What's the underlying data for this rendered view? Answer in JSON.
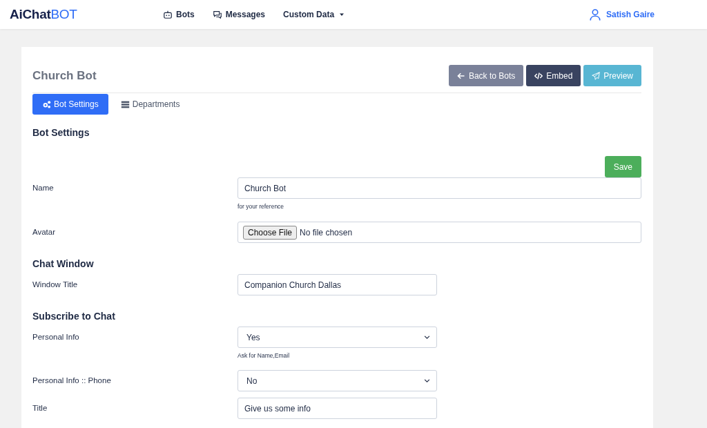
{
  "navbar": {
    "logo": "**AiChat**BOT",
    "links": [
      {
        "label": "Bots",
        "kind": "robot",
        "dropdown": false
      },
      {
        "label": "Messages",
        "kind": "chat",
        "dropdown": false
      },
      {
        "label": "Custom Data",
        "kind": "menu",
        "dropdown": true
      }
    ],
    "user": "Satish Gaire"
  },
  "page": {
    "title": "Church Bot",
    "buttons": [
      {
        "label": "Back to Bots",
        "kind": "back"
      },
      {
        "label": "Embed",
        "kind": "embed"
      },
      {
        "label": "Preview",
        "kind": "preview"
      }
    ]
  },
  "tabs": [
    {
      "label": "Bot Settings",
      "kind": "settings",
      "selected": true
    },
    {
      "label": "Departments",
      "kind": "list",
      "selected": false
    }
  ],
  "sections": [
    {
      "heading": "Bot Settings",
      "save": "Save",
      "fields": [
        {
          "label": "Name",
          "kind": "text",
          "value": "Church Bot",
          "help": "for your reference"
        },
        {
          "label": "Avatar",
          "kind": "file",
          "button": "Choose File",
          "value": "No file chosen"
        }
      ]
    },
    {
      "heading": "Chat Window",
      "fields": [
        {
          "label": "Window Title",
          "kind": "text",
          "value": "Companion Church Dallas"
        }
      ]
    },
    {
      "heading": "Subscribe to Chat",
      "fields": [
        {
          "label": "Personal Info",
          "kind": "select",
          "value": "Yes",
          "help": "Ask for Name,Email"
        },
        {
          "label": "Personal Info :: Phone",
          "kind": "select",
          "value": "No"
        },
        {
          "label": "Title",
          "kind": "text",
          "value": "Give us some info"
        }
      ]
    }
  ]
}
